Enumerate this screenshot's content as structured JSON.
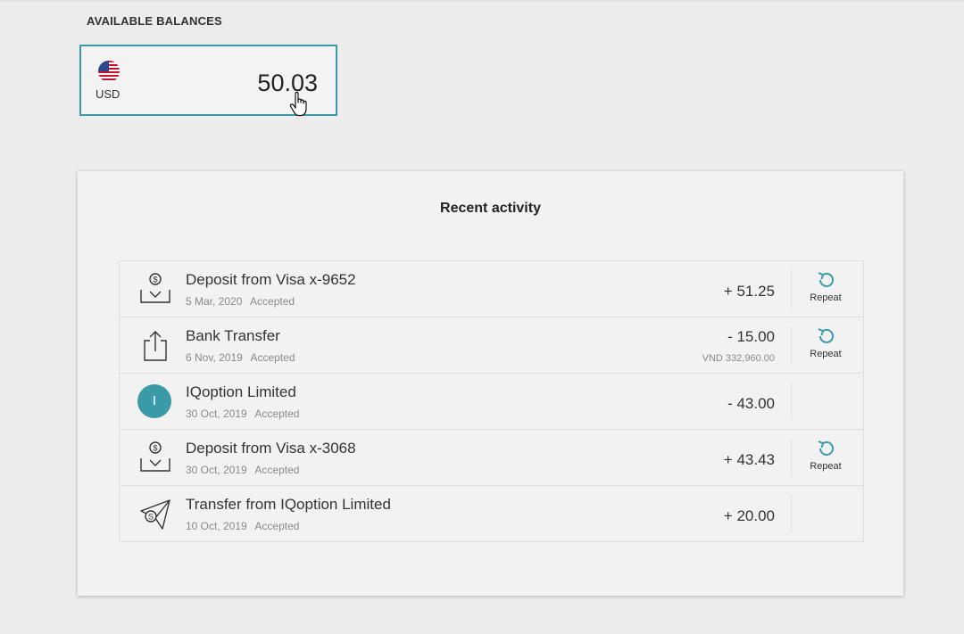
{
  "balances": {
    "title": "AVAILABLE BALANCES",
    "card": {
      "currency": "USD",
      "amount": "50.03",
      "flag_icon": "us-flag-icon"
    }
  },
  "activity": {
    "title": "Recent activity",
    "repeat_label": "Repeat",
    "accent_color": "#3a9aa8",
    "items": [
      {
        "title": "Deposit from Visa x-9652",
        "date": "5 Mar, 2020",
        "status": "Accepted",
        "amount": "+ 51.25",
        "sub": "",
        "icon": "deposit-icon",
        "repeat": true
      },
      {
        "title": "Bank Transfer",
        "date": "6 Nov, 2019",
        "status": "Accepted",
        "amount": "- 15.00",
        "sub": "VND 332,960.00",
        "icon": "upload-icon",
        "repeat": true
      },
      {
        "title": "IQoption Limited",
        "date": "30 Oct, 2019",
        "status": "Accepted",
        "amount": "- 43.00",
        "sub": "",
        "icon": "avatar",
        "avatar_letter": "I",
        "repeat": false
      },
      {
        "title": "Deposit from Visa x-3068",
        "date": "30 Oct, 2019",
        "status": "Accepted",
        "amount": "+ 43.43",
        "sub": "",
        "icon": "deposit-icon",
        "repeat": true
      },
      {
        "title": "Transfer from IQoption Limited",
        "date": "10 Oct, 2019",
        "status": "Accepted",
        "amount": "+ 20.00",
        "sub": "",
        "icon": "send-money-icon",
        "repeat": false
      }
    ]
  }
}
